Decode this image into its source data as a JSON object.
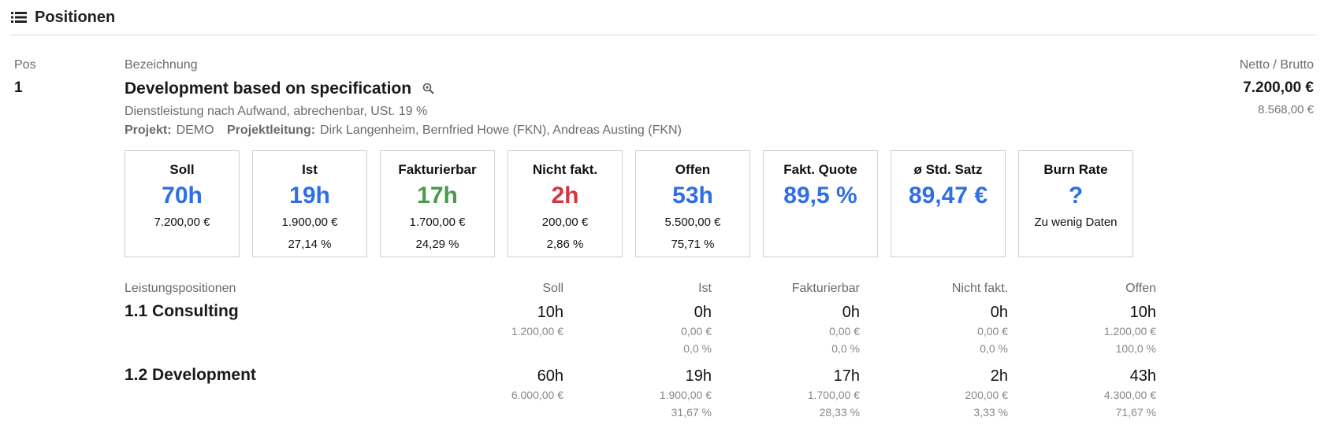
{
  "header": {
    "title": "Positionen",
    "icon": "list-icon"
  },
  "columns": {
    "pos": "Pos",
    "bezeichnung": "Bezeichnung",
    "netto_brutto": "Netto / Brutto"
  },
  "item": {
    "pos": "1",
    "title": "Development based on specification",
    "subtitle": "Dienstleistung nach Aufwand, abrechenbar, USt. 19 %",
    "projekt_label": "Projekt:",
    "projekt_value": "DEMO",
    "projektleitung_label": "Projektleitung:",
    "projektleitung_value": "Dirk Langenheim, Bernfried Howe (FKN), Andreas Austing (FKN)",
    "netto": "7.200,00 €",
    "brutto": "8.568,00 €"
  },
  "kpis": [
    {
      "title": "Soll",
      "value": "70h",
      "color": "#2f6fe4",
      "line1": "7.200,00 €",
      "line2": ""
    },
    {
      "title": "Ist",
      "value": "19h",
      "color": "#2f6fe4",
      "line1": "1.900,00 €",
      "line2": "27,14 %"
    },
    {
      "title": "Fakturierbar",
      "value": "17h",
      "color": "#4a9a4a",
      "line1": "1.700,00 €",
      "line2": "24,29 %"
    },
    {
      "title": "Nicht fakt.",
      "value": "2h",
      "color": "#d0393f",
      "line1": "200,00 €",
      "line2": "2,86 %"
    },
    {
      "title": "Offen",
      "value": "53h",
      "color": "#2f6fe4",
      "line1": "5.500,00 €",
      "line2": "75,71 %"
    },
    {
      "title": "Fakt. Quote",
      "value": "89,5 %",
      "color": "#2f6fe4",
      "line1": "",
      "line2": ""
    },
    {
      "title": "ø Std. Satz",
      "value": "89,47 €",
      "color": "#2f6fe4",
      "line1": "",
      "line2": ""
    },
    {
      "title": "Burn Rate",
      "value": "?",
      "color": "#2f6fe4",
      "line1": "Zu wenig Daten",
      "line2": ""
    }
  ],
  "leistung": {
    "label": "Leistungspositionen",
    "headers": [
      "Soll",
      "Ist",
      "Fakturierbar",
      "Nicht fakt.",
      "Offen"
    ],
    "rows": [
      {
        "name": "1.1  Consulting",
        "cells": [
          {
            "h": "10h",
            "eur": "1.200,00 €",
            "pct": ""
          },
          {
            "h": "0h",
            "eur": "0,00 €",
            "pct": "0,0 %"
          },
          {
            "h": "0h",
            "eur": "0,00 €",
            "pct": "0,0 %"
          },
          {
            "h": "0h",
            "eur": "0,00 €",
            "pct": "0,0 %"
          },
          {
            "h": "10h",
            "eur": "1.200,00 €",
            "pct": "100,0 %"
          }
        ]
      },
      {
        "name": "1.2  Development",
        "cells": [
          {
            "h": "60h",
            "eur": "6.000,00 €",
            "pct": ""
          },
          {
            "h": "19h",
            "eur": "1.900,00 €",
            "pct": "31,67 %"
          },
          {
            "h": "17h",
            "eur": "1.700,00 €",
            "pct": "28,33 %"
          },
          {
            "h": "2h",
            "eur": "200,00 €",
            "pct": "3,33 %"
          },
          {
            "h": "43h",
            "eur": "4.300,00 €",
            "pct": "71,67 %"
          }
        ]
      }
    ]
  }
}
